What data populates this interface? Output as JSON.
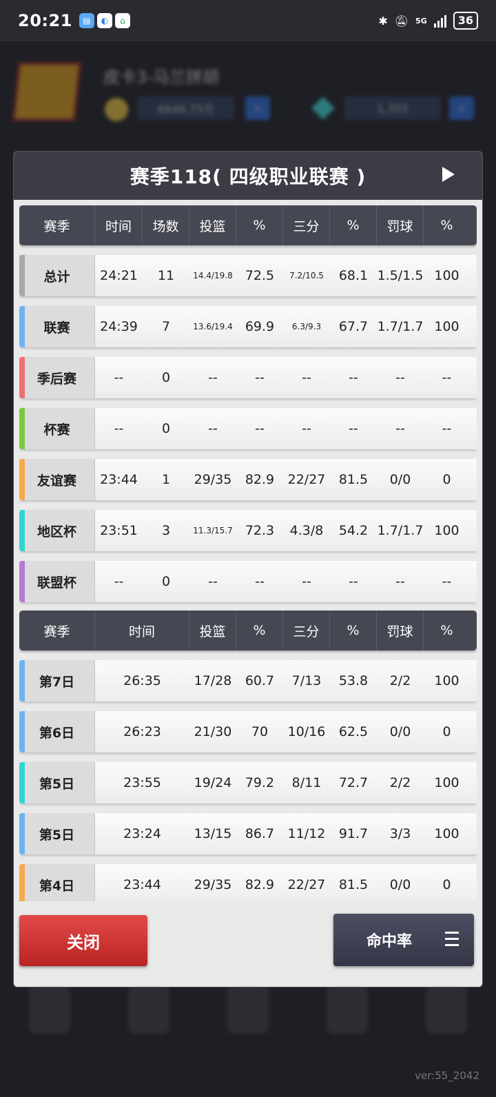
{
  "status": {
    "time": "20:21",
    "network": "5G",
    "battery": "36"
  },
  "background": {
    "team_name": "皮卡3-马兰拼胡",
    "coins": "6646.75万",
    "gems": "1,355"
  },
  "modal": {
    "title": "赛季118( 四级职业联赛 )",
    "close_label": "关闭",
    "sort_label": "命中率"
  },
  "season_table": {
    "headers": [
      "赛季",
      "时间",
      "场数",
      "投篮",
      "%",
      "三分",
      "%",
      "罚球",
      "%"
    ],
    "rows": [
      {
        "name": "总计",
        "color": "#a8a8a8",
        "cells": [
          "24:21",
          "11",
          "14.4/19.8",
          "72.5",
          "7.2/10.5",
          "68.1",
          "1.5/1.5",
          "100"
        ]
      },
      {
        "name": "联赛",
        "color": "#6cb4f0",
        "cells": [
          "24:39",
          "7",
          "13.6/19.4",
          "69.9",
          "6.3/9.3",
          "67.7",
          "1.7/1.7",
          "100"
        ]
      },
      {
        "name": "季后赛",
        "color": "#f07070",
        "cells": [
          "--",
          "0",
          "--",
          "--",
          "--",
          "--",
          "--",
          "--"
        ]
      },
      {
        "name": "杯赛",
        "color": "#7cc83a",
        "cells": [
          "--",
          "0",
          "--",
          "--",
          "--",
          "--",
          "--",
          "--"
        ]
      },
      {
        "name": "友谊赛",
        "color": "#f5a94a",
        "cells": [
          "23:44",
          "1",
          "29/35",
          "82.9",
          "22/27",
          "81.5",
          "0/0",
          "0"
        ]
      },
      {
        "name": "地区杯",
        "color": "#2ed6d0",
        "cells": [
          "23:51",
          "3",
          "11.3/15.7",
          "72.3",
          "4.3/8",
          "54.2",
          "1.7/1.7",
          "100"
        ]
      },
      {
        "name": "联盟杯",
        "color": "#b57ad6",
        "cells": [
          "--",
          "0",
          "--",
          "--",
          "--",
          "--",
          "--",
          "--"
        ]
      }
    ]
  },
  "game_table": {
    "headers": [
      "赛季",
      "时间",
      "投篮",
      "%",
      "三分",
      "%",
      "罚球",
      "%"
    ],
    "rows": [
      {
        "name": "第7日",
        "color": "#6cb4f0",
        "cells": [
          "26:35",
          "17/28",
          "60.7",
          "7/13",
          "53.8",
          "2/2",
          "100"
        ]
      },
      {
        "name": "第6日",
        "color": "#6cb4f0",
        "cells": [
          "26:23",
          "21/30",
          "70",
          "10/16",
          "62.5",
          "0/0",
          "0"
        ]
      },
      {
        "name": "第5日",
        "color": "#2ed6d0",
        "cells": [
          "23:55",
          "19/24",
          "79.2",
          "8/11",
          "72.7",
          "2/2",
          "100"
        ]
      },
      {
        "name": "第5日",
        "color": "#6cb4f0",
        "cells": [
          "23:24",
          "13/15",
          "86.7",
          "11/12",
          "91.7",
          "3/3",
          "100"
        ]
      },
      {
        "name": "第4日",
        "color": "#f5a94a",
        "cells": [
          "23:44",
          "29/35",
          "82.9",
          "22/27",
          "81.5",
          "0/0",
          "0"
        ]
      }
    ]
  },
  "version": "ver:55_2042"
}
